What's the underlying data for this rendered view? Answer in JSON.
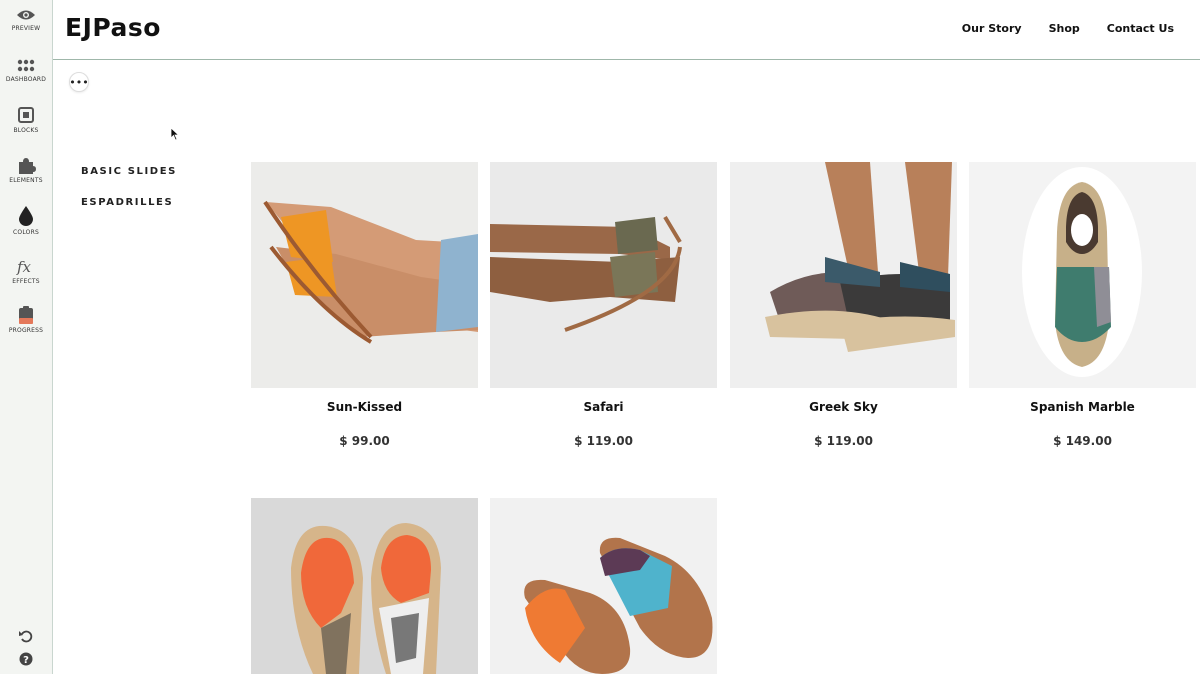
{
  "editor": {
    "items": [
      {
        "label": "PREVIEW",
        "icon": "eye-icon"
      },
      {
        "label": "DASHBOARD",
        "icon": "grid-dots-icon"
      },
      {
        "label": "BLOCKS",
        "icon": "blocks-icon"
      },
      {
        "label": "ELEMENTS",
        "icon": "puzzle-icon"
      },
      {
        "label": "COLORS",
        "icon": "drop-icon"
      },
      {
        "label": "EFFECTS",
        "icon": "fx-icon"
      },
      {
        "label": "PROGRESS",
        "icon": "clipboard-icon"
      }
    ],
    "undo_icon": "undo-icon",
    "help_icon": "help-icon"
  },
  "site": {
    "logo": "EJPaso",
    "nav": [
      "Our Story",
      "Shop",
      "Contact Us"
    ]
  },
  "categories": [
    "BASIC SLIDES",
    "ESPADRILLES"
  ],
  "products": [
    {
      "name": "Sun-Kissed",
      "price": "$ 99.00"
    },
    {
      "name": "Safari",
      "price": "$ 119.00"
    },
    {
      "name": "Greek Sky",
      "price": "$ 119.00"
    },
    {
      "name": "Spanish Marble",
      "price": "$ 149.00"
    },
    {
      "name": "",
      "price": ""
    },
    {
      "name": "",
      "price": ""
    }
  ],
  "more_label": "•••",
  "colors": {
    "rail_bg": "#f3f5f2",
    "divider": "#9fb7aa",
    "progress_accent": "#e4785a"
  }
}
